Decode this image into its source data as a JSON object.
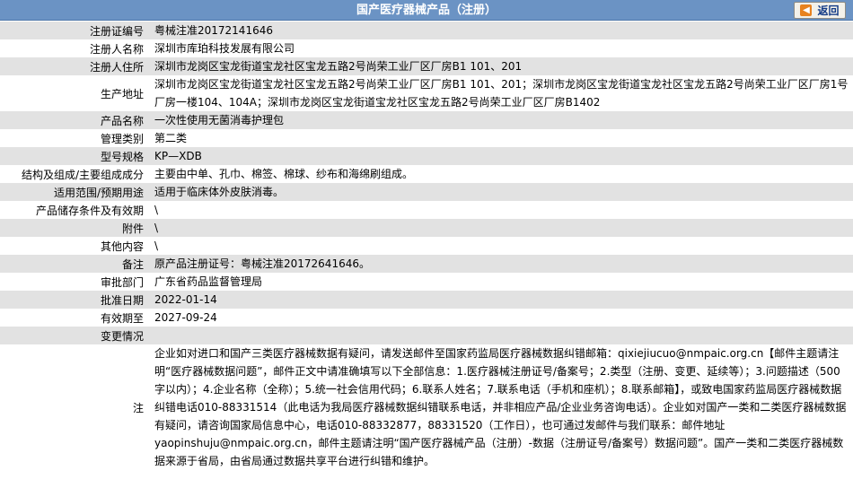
{
  "header": {
    "title": "国产医疗器械产品（注册）",
    "back_label": "返回"
  },
  "rows": [
    {
      "label": "注册证编号",
      "value": "粤械注准20172141646"
    },
    {
      "label": "注册人名称",
      "value": "深圳市库珀科技发展有限公司"
    },
    {
      "label": "注册人住所",
      "value": "深圳市龙岗区宝龙街道宝龙社区宝龙五路2号尚荣工业厂区厂房B1 101、201"
    },
    {
      "label": "生产地址",
      "value": "深圳市龙岗区宝龙街道宝龙社区宝龙五路2号尚荣工业厂区厂房B1 101、201；深圳市龙岗区宝龙街道宝龙社区宝龙五路2号尚荣工业厂区厂房1号厂房一楼104、104A；深圳市龙岗区宝龙街道宝龙社区宝龙五路2号尚荣工业厂区厂房B1402"
    },
    {
      "label": "产品名称",
      "value": "一次性使用无菌消毒护理包"
    },
    {
      "label": "管理类别",
      "value": "第二类"
    },
    {
      "label": "型号规格",
      "value": "KP—XDB"
    },
    {
      "label": "结构及组成/主要组成成分",
      "value": "主要由中单、孔巾、棉签、棉球、纱布和海绵刷组成。"
    },
    {
      "label": "适用范围/预期用途",
      "value": "适用于临床体外皮肤消毒。"
    },
    {
      "label": "产品储存条件及有效期",
      "value": "\\"
    },
    {
      "label": "附件",
      "value": "\\"
    },
    {
      "label": "其他内容",
      "value": "\\"
    },
    {
      "label": "备注",
      "value": "原产品注册证号：粤械注准20172641646。"
    },
    {
      "label": "审批部门",
      "value": "广东省药品监督管理局"
    },
    {
      "label": "批准日期",
      "value": "2022-01-14"
    },
    {
      "label": "有效期至",
      "value": "2027-09-24"
    },
    {
      "label": "变更情况",
      "value": ""
    }
  ],
  "notice": {
    "label": "注",
    "text": "企业如对进口和国产三类医疗器械数据有疑问，请发送邮件至国家药监局医疗器械数据纠错邮箱：qixiejiucuo@nmpaic.org.cn【邮件主题请注明“医疗器械数据问题”，邮件正文中请准确填写以下全部信息：1.医疗器械注册证号/备案号；2.类型（注册、变更、延续等）；3.问题描述（500字以内）；4.企业名称（全称）；5.统一社会信用代码；6.联系人姓名；7.联系电话（手机和座机）；8.联系邮箱】，或致电国家药监局医疗器械数据纠错电话010-88331514（此电话为我局医疗器械数据纠错联系电话，并非相应产品/企业业务咨询电话）。企业如对国产一类和二类医疗器械数据有疑问，请咨询国家局信息中心，电话010-88332877，88331520（工作日），也可通过发邮件与我们联系：邮件地址yaopinshuju@nmpaic.org.cn，邮件主题请注明“国产医疗器械产品（注册）-数据（注册证号/备案号）数据问题”。国产一类和二类医疗器械数据来源于省局，由省局通过数据共享平台进行纠错和维护。"
  }
}
